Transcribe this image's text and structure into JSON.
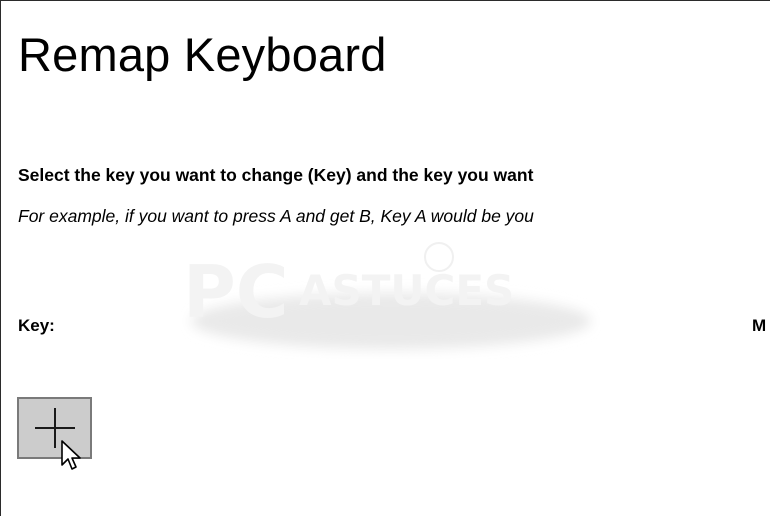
{
  "header": {
    "title": "Remap Keyboard"
  },
  "instructions": {
    "primary": "Select the key you want to change (Key) and the key you want",
    "example": "For example, if you want to press A and get B, Key A would be you"
  },
  "columns": {
    "key_label": "Key:",
    "mapped_label": "M"
  },
  "actions": {
    "add_button_icon": "plus-icon"
  },
  "watermark": {
    "logo_text": "PCASTUCES"
  },
  "colors": {
    "button_fill": "#cccccc",
    "button_border": "#7a7a7a",
    "text": "#000000",
    "background": "#ffffff"
  }
}
